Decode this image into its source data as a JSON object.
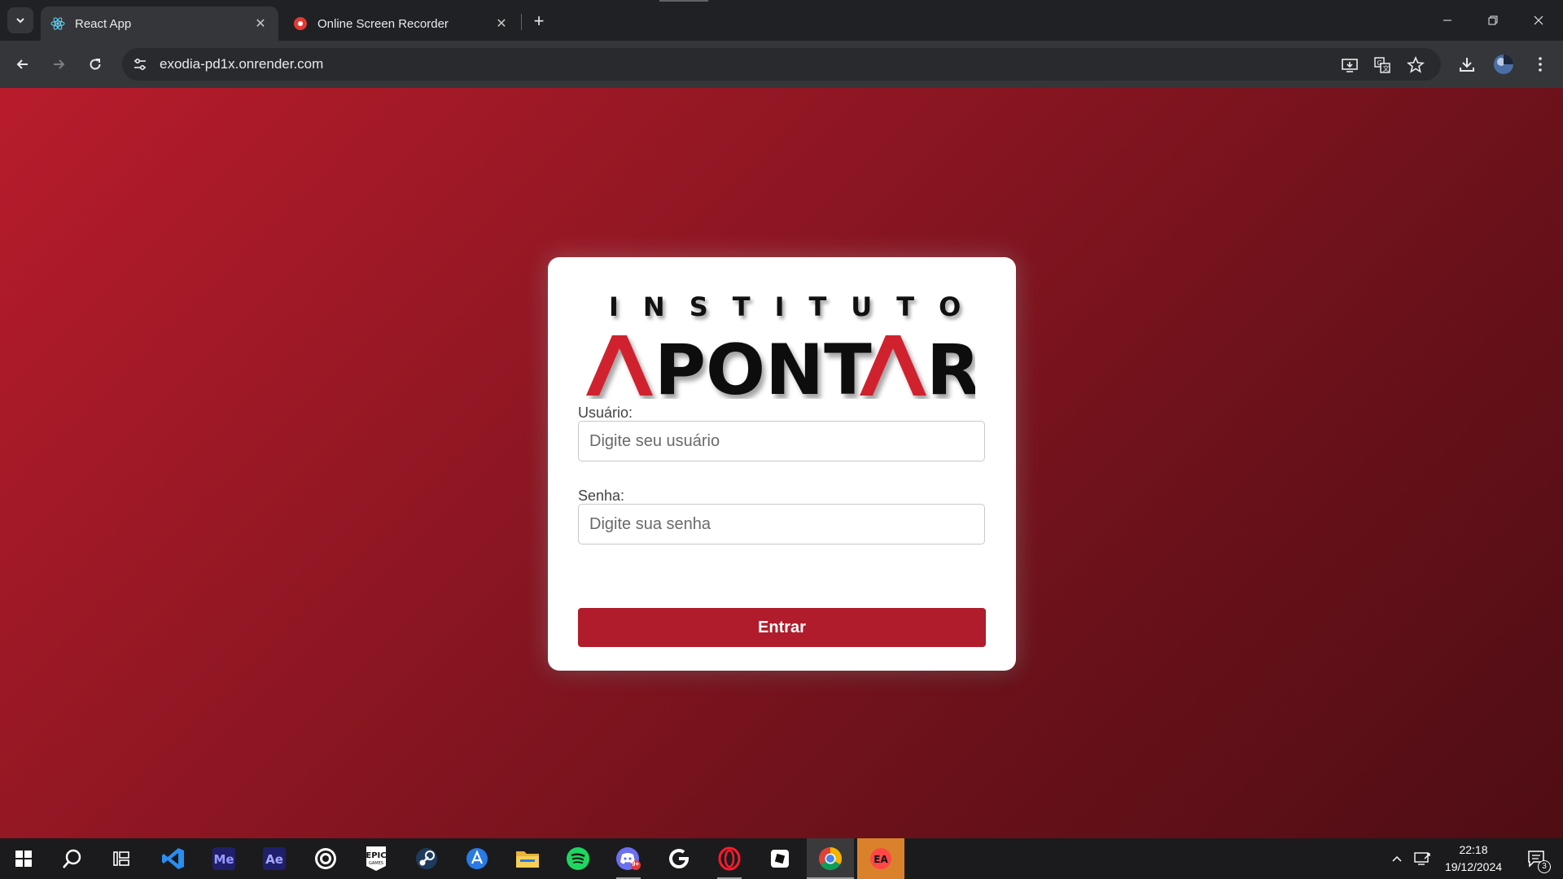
{
  "browser": {
    "tabs": [
      {
        "title": "React App",
        "active": true
      },
      {
        "title": "Online Screen Recorder",
        "active": false
      }
    ],
    "url": "exodia-pd1x.onrender.com"
  },
  "logo": {
    "top_text": "INSTITUTO",
    "main_text": "APONTAR"
  },
  "login": {
    "username_label": "Usuário:",
    "username_placeholder": "Digite seu usuário",
    "password_label": "Senha:",
    "password_placeholder": "Digite sua senha",
    "submit_label": "Entrar"
  },
  "taskbar": {
    "apps": [
      "start",
      "search",
      "task-view",
      "vscode",
      "media-encoder",
      "after-effects",
      "ubisoft-connect",
      "epic-games",
      "steam",
      "app-installer",
      "file-explorer",
      "spotify",
      "discord",
      "g-hub",
      "opera",
      "roblox-studio",
      "chrome",
      "ea-app"
    ],
    "clock_time": "22:18",
    "clock_date": "19/12/2024",
    "notification_count": "3",
    "discord_badge": "9+"
  },
  "colors": {
    "accent": "#b01c2b",
    "gradient_start": "#b81c2c",
    "gradient_end": "#4f0d14"
  }
}
